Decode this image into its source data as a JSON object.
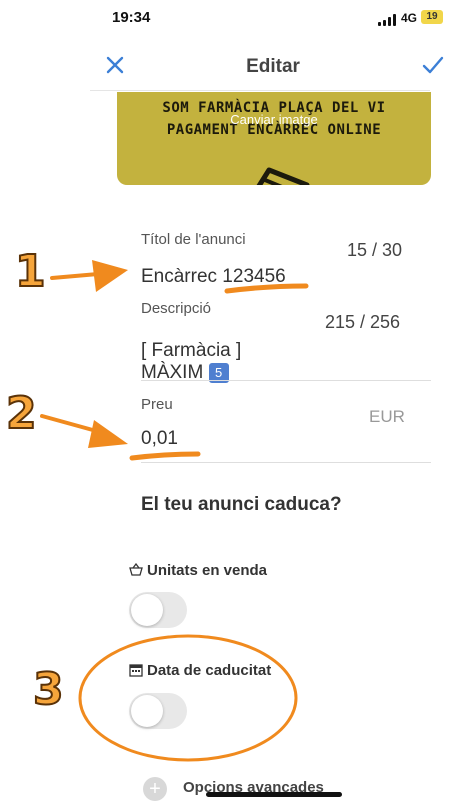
{
  "status_bar": {
    "time": "19:34",
    "network": "4G",
    "battery": "19"
  },
  "nav": {
    "close_icon": "close-icon",
    "title": "Editar",
    "confirm_icon": "checkmark-icon"
  },
  "banner": {
    "line1": "SOM FARMÀCIA PLAÇA DEL VI",
    "line2": "PAGAMENT ENCÀRREC ONLINE",
    "change_label": "Canviar imatge"
  },
  "form": {
    "title": {
      "label": "Títol de l'anunci",
      "value": "Encàrrec 123456",
      "counter": "15 / 30"
    },
    "description": {
      "label": "Descripció",
      "line1": "[ Farmàcia ]",
      "line2": "MÀXIM",
      "badge": "5",
      "counter": "215 / 256"
    },
    "price": {
      "label": "Preu",
      "value": "0,01",
      "currency": "EUR"
    }
  },
  "expiry": {
    "heading": "El teu anunci caduca?",
    "units": {
      "label": "Unitats en venda",
      "enabled": false
    },
    "date": {
      "label": "Data de caducitat",
      "enabled": false
    }
  },
  "advanced": {
    "label": "Opcions avançades"
  },
  "annotations": {
    "n1": "1",
    "n2": "2",
    "n3": "3",
    "color": "#f08a1e"
  }
}
